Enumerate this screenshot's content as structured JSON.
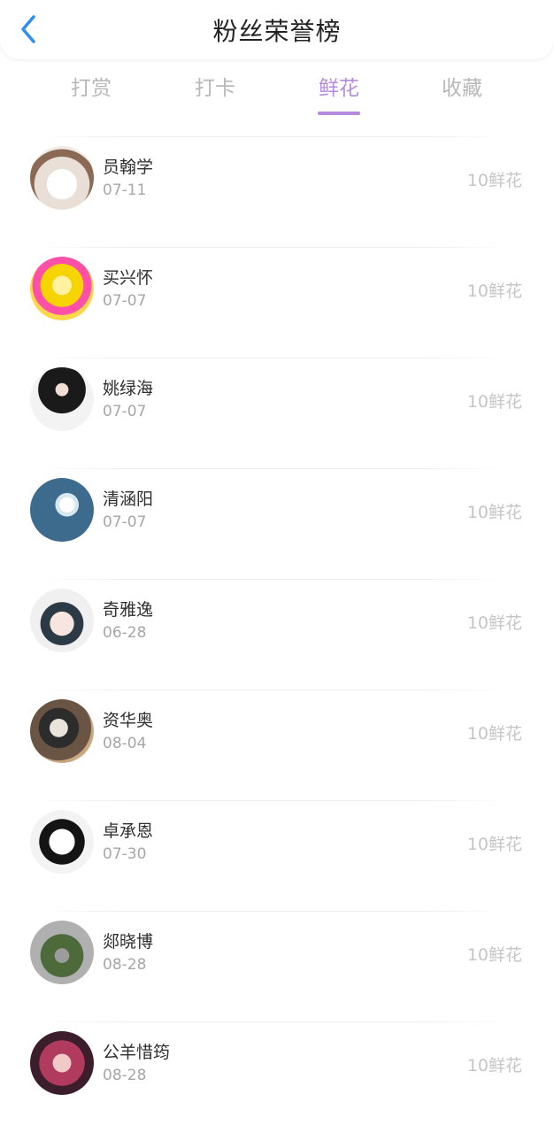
{
  "header": {
    "title": "粉丝荣誉榜"
  },
  "tabs": [
    {
      "label": "打赏"
    },
    {
      "label": "打卡"
    },
    {
      "label": "鲜花",
      "active": true
    },
    {
      "label": "收藏"
    }
  ],
  "rows": [
    {
      "name": "员翰学",
      "date": "07-11",
      "amount": "10鲜花"
    },
    {
      "name": "买兴怀",
      "date": "07-07",
      "amount": "10鲜花"
    },
    {
      "name": "姚绿海",
      "date": "07-07",
      "amount": "10鲜花"
    },
    {
      "name": "清涵阳",
      "date": "07-07",
      "amount": "10鲜花"
    },
    {
      "name": "奇雅逸",
      "date": "06-28",
      "amount": "10鲜花"
    },
    {
      "name": "资华奥",
      "date": "08-04",
      "amount": "10鲜花"
    },
    {
      "name": "卓承恩",
      "date": "07-30",
      "amount": "10鲜花"
    },
    {
      "name": "郯晓博",
      "date": "08-28",
      "amount": "10鲜花"
    },
    {
      "name": "公羊惜筠",
      "date": "08-28",
      "amount": "10鲜花"
    }
  ],
  "colors": {
    "accent": "#b58be0",
    "back_icon": "#2f8df2",
    "inactive_tab": "#b7b7b7"
  }
}
